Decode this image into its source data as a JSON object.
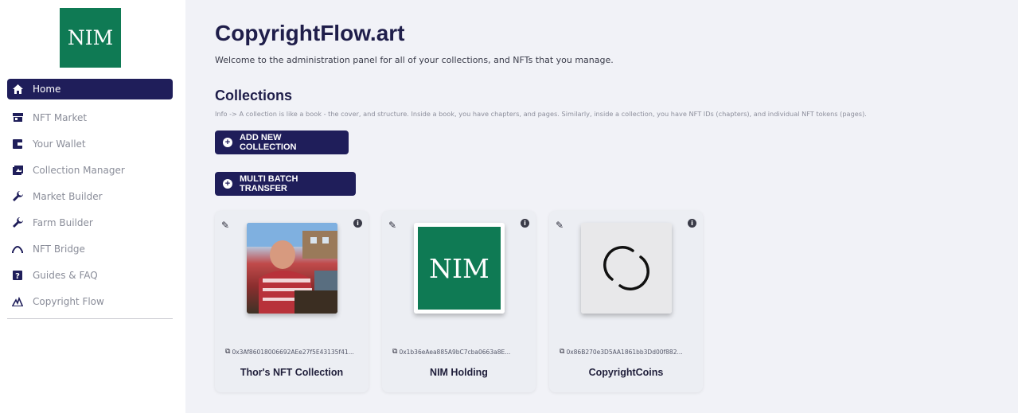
{
  "sidebar": {
    "logo_text": "NIM",
    "brand_color": "#0f7a54",
    "items": [
      {
        "label": "Home",
        "icon": "home-icon",
        "active": true
      },
      {
        "label": "NFT Market",
        "icon": "store-icon"
      },
      {
        "label": "Your Wallet",
        "icon": "wallet-icon"
      },
      {
        "label": "Collection Manager",
        "icon": "collections-icon"
      },
      {
        "label": "Market Builder",
        "icon": "wrench-icon"
      },
      {
        "label": "Farm Builder",
        "icon": "wrench-icon"
      },
      {
        "label": "NFT Bridge",
        "icon": "bridge-icon"
      },
      {
        "label": "Guides & FAQ",
        "icon": "help-icon"
      },
      {
        "label": "Copyright Flow",
        "icon": "copyright-flow-icon"
      }
    ]
  },
  "main": {
    "title": "CopyrightFlow.art",
    "subtitle": "Welcome to the administration panel for all of your collections, and NFTs that you manage.",
    "section_title": "Collections",
    "info": "Info -> A collection is like a book - the cover, and structure. Inside a book, you have chapters, and pages. Similarly, inside a collection, you have NFT IDs (chapters), and individual NFT tokens (pages).",
    "add_collection_label": "ADD NEW COLLECTION",
    "batch_transfer_label": "MULTI BATCH TRANSFER",
    "accent_color": "#1f1e5a",
    "collections": [
      {
        "name": "Thor's NFT Collection",
        "address": "0x3Af86018006692AEe27f5E43135f41...",
        "image": "person-photo"
      },
      {
        "name": "NIM Holding",
        "address": "0x1b36eAea885A9bC7cba0663a8E...",
        "image": "nim-logo",
        "image_text": "NIM"
      },
      {
        "name": "CopyrightCoins",
        "address": "0x86B270e3D5AA1861bb3Dd00f882...",
        "image": "copyrightflow-logo"
      }
    ]
  }
}
